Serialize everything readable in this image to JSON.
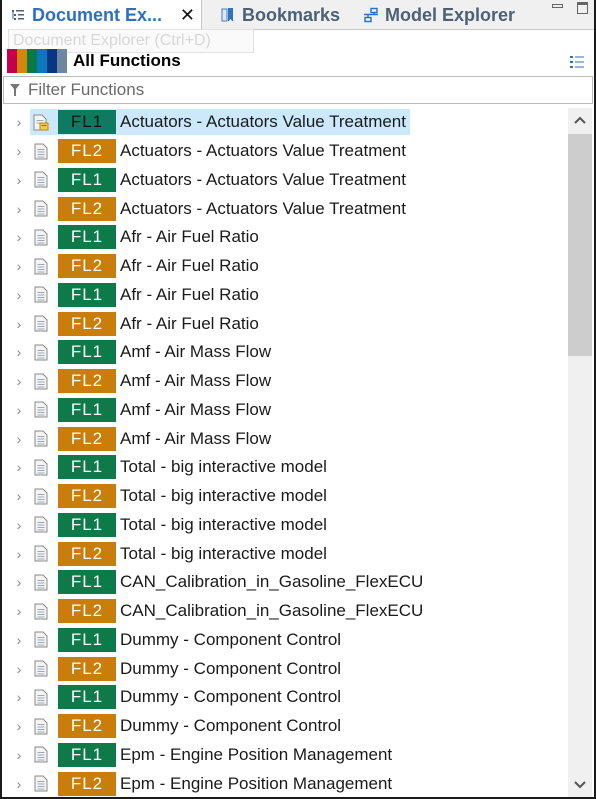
{
  "tabs": [
    {
      "label": "Document Ex...",
      "icon": "document-explorer-icon",
      "active": true,
      "closable": true
    },
    {
      "label": "Bookmarks",
      "icon": "bookmarks-icon",
      "active": false
    },
    {
      "label": "Model Explorer",
      "icon": "model-explorer-icon",
      "active": false
    }
  ],
  "tooltip": "Document Explorer (Ctrl+D)",
  "header": {
    "title": "All Functions",
    "color_strip": [
      "#c4004f",
      "#d4860b",
      "#0a7a45",
      "#0a78c0",
      "#0a3580",
      "#6e86a0"
    ]
  },
  "filter": {
    "placeholder": "Filter Functions",
    "value": ""
  },
  "colors": {
    "fl1": "#0e7a4a",
    "fl2": "#c97d0a",
    "selection": "#cce8fb",
    "active_tab_text": "#2e6fbf"
  },
  "rows": [
    {
      "badge": "FL1",
      "label": "Actuators - Actuators Value Treatment",
      "selected": true
    },
    {
      "badge": "FL2",
      "label": "Actuators - Actuators Value Treatment"
    },
    {
      "badge": "FL1",
      "label": "Actuators - Actuators Value Treatment"
    },
    {
      "badge": "FL2",
      "label": "Actuators - Actuators Value Treatment"
    },
    {
      "badge": "FL1",
      "label": "Afr - Air Fuel Ratio"
    },
    {
      "badge": "FL2",
      "label": "Afr - Air Fuel Ratio"
    },
    {
      "badge": "FL1",
      "label": "Afr - Air Fuel Ratio"
    },
    {
      "badge": "FL2",
      "label": "Afr - Air Fuel Ratio"
    },
    {
      "badge": "FL1",
      "label": "Amf - Air Mass Flow"
    },
    {
      "badge": "FL2",
      "label": "Amf - Air Mass Flow"
    },
    {
      "badge": "FL1",
      "label": "Amf - Air Mass Flow"
    },
    {
      "badge": "FL2",
      "label": "Amf - Air Mass Flow"
    },
    {
      "badge": "FL1",
      "label": "Total - big interactive model"
    },
    {
      "badge": "FL2",
      "label": "Total - big interactive model"
    },
    {
      "badge": "FL1",
      "label": "Total - big interactive model"
    },
    {
      "badge": "FL2",
      "label": "Total - big interactive model"
    },
    {
      "badge": "FL1",
      "label": "CAN_Calibration_in_Gasoline_FlexECU"
    },
    {
      "badge": "FL2",
      "label": "CAN_Calibration_in_Gasoline_FlexECU"
    },
    {
      "badge": "FL1",
      "label": "Dummy - Component Control"
    },
    {
      "badge": "FL2",
      "label": "Dummy - Component Control"
    },
    {
      "badge": "FL1",
      "label": "Dummy - Component Control"
    },
    {
      "badge": "FL2",
      "label": "Dummy - Component Control"
    },
    {
      "badge": "FL1",
      "label": "Epm - Engine Position Management"
    },
    {
      "badge": "FL2",
      "label": "Epm - Engine Position Management"
    }
  ]
}
